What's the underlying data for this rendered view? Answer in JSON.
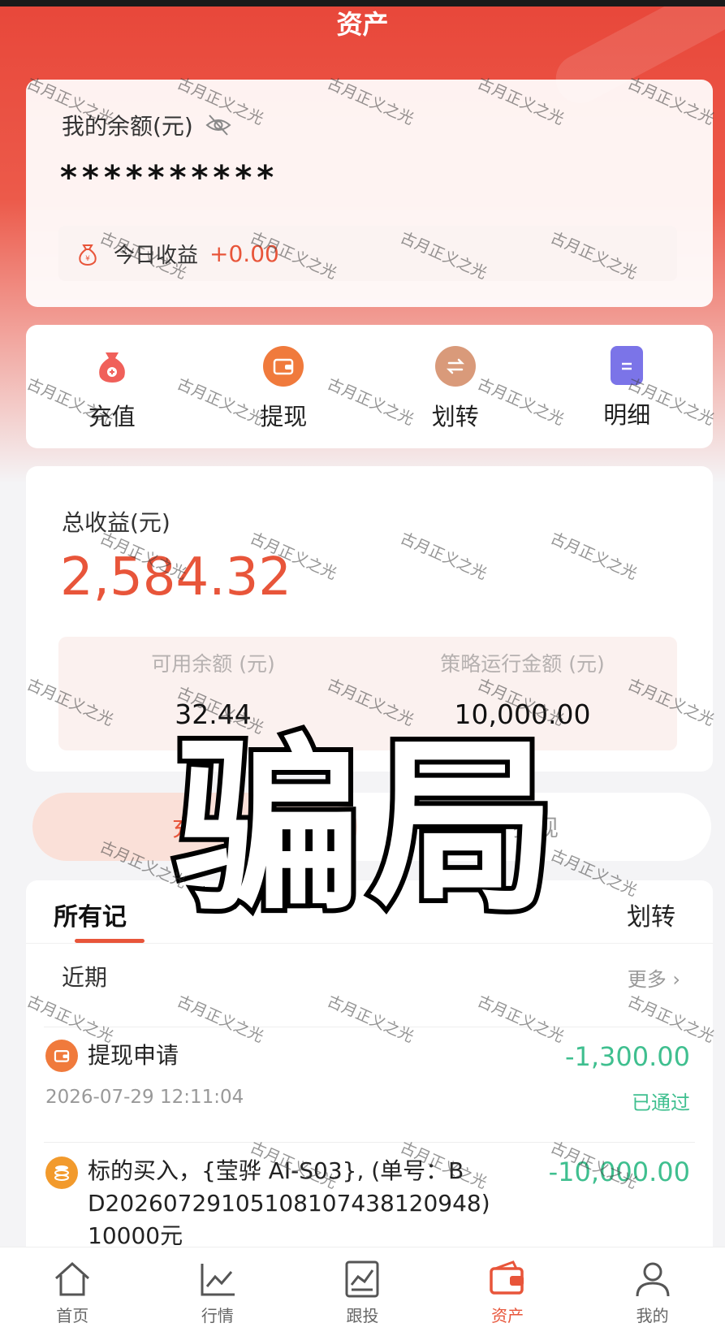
{
  "header": {
    "title": "资产"
  },
  "balance": {
    "label": "我的余额(元)",
    "masked_value": "**********",
    "today_label": "今日收益",
    "today_value": "+0.00"
  },
  "actions": [
    {
      "label": "充值",
      "icon": "money-bag-icon",
      "color": "#f0605a"
    },
    {
      "label": "提现",
      "icon": "wallet-icon",
      "color": "#f07a3c"
    },
    {
      "label": "划转",
      "icon": "swap-icon",
      "color": "#d99a7a"
    },
    {
      "label": "明细",
      "icon": "document-icon",
      "color": "#7b74e8"
    }
  ],
  "income": {
    "label": "总收益(元)",
    "value": "2,584.32",
    "available_label": "可用余额 (元)",
    "available_value": "32.44",
    "strategy_label": "策略运行金额 (元)",
    "strategy_value": "10,000.00"
  },
  "segment": {
    "left": "充值",
    "right": "提现"
  },
  "records": {
    "tabs": [
      "所有记",
      "划转"
    ],
    "recent_label": "近期",
    "more_label": "更多",
    "items": [
      {
        "title": "提现申请",
        "time": "2026-07-29 12:11:04",
        "amount": "-1,300.00",
        "status": "已通过",
        "icon": "wallet-icon"
      },
      {
        "title_line1": "标的买入，{莹骅 AI-S03}, (单号：B",
        "title_line2": "D20260729105108107438120948)",
        "title_line3": "10000元",
        "amount": "-10,000.00",
        "icon": "coins-icon"
      }
    ]
  },
  "overlay": {
    "text": "骗局"
  },
  "watermark": {
    "text": "古月正义之光"
  },
  "nav": [
    {
      "label": "首页",
      "icon": "home-icon"
    },
    {
      "label": "行情",
      "icon": "chart-icon"
    },
    {
      "label": "跟投",
      "icon": "follow-icon"
    },
    {
      "label": "资产",
      "icon": "wallet-icon",
      "active": true
    },
    {
      "label": "我的",
      "icon": "profile-icon"
    }
  ],
  "colors": {
    "accent": "#e8553a",
    "positive_green": "#3fbf8f",
    "header_red": "#e8473a"
  }
}
